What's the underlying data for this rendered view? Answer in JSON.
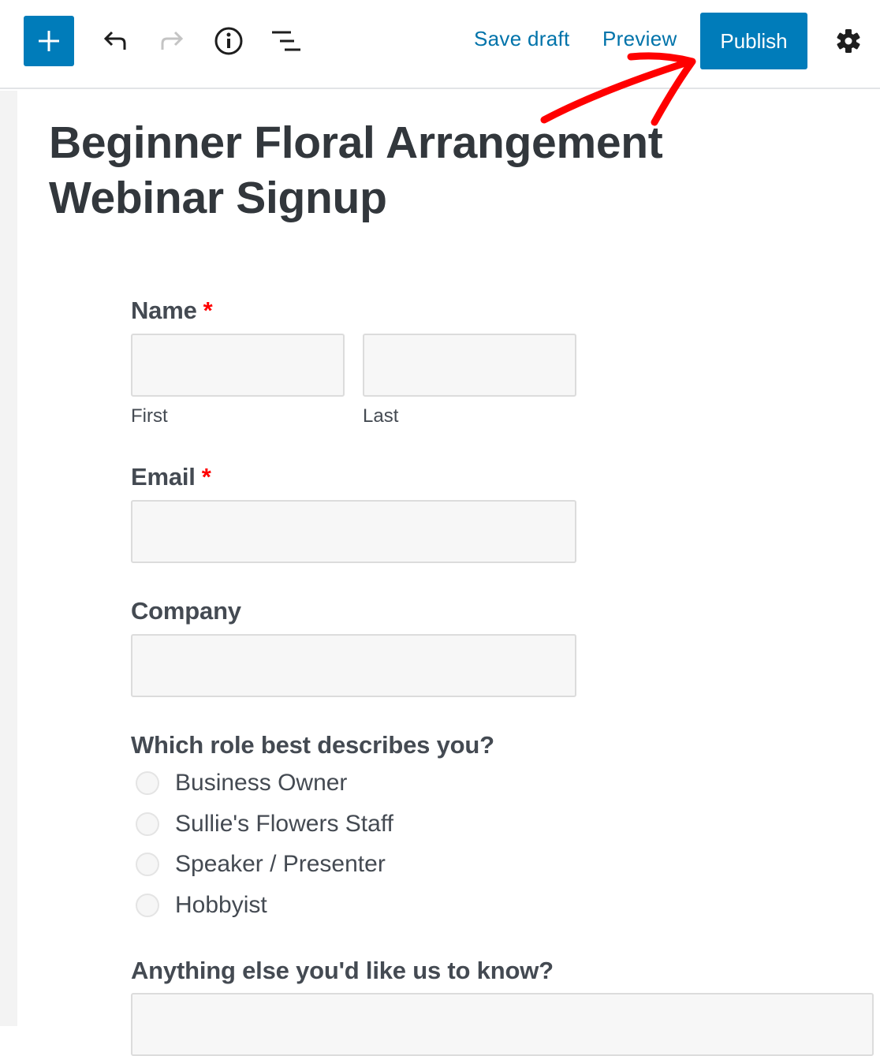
{
  "toolbar": {
    "add_block_icon": "plus-icon",
    "undo_icon": "undo-icon",
    "redo_icon": "redo-icon",
    "info_icon": "info-icon",
    "outline_icon": "list-outline-icon",
    "save_draft_label": "Save draft",
    "preview_label": "Preview",
    "publish_label": "Publish",
    "settings_icon": "gear-icon",
    "accent_color": "#007cba",
    "link_color": "#0073aa"
  },
  "page": {
    "title": "Beginner Floral Arrangement Webinar Signup"
  },
  "form": {
    "name": {
      "label": "Name",
      "required_mark": "*",
      "first_sublabel": "First",
      "last_sublabel": "Last",
      "first_value": "",
      "last_value": ""
    },
    "email": {
      "label": "Email",
      "required_mark": "*",
      "value": ""
    },
    "company": {
      "label": "Company",
      "value": ""
    },
    "role": {
      "label": "Which role best describes you?",
      "options": [
        {
          "label": "Business Owner",
          "checked": false
        },
        {
          "label": "Sullie's Flowers Staff",
          "checked": false
        },
        {
          "label": "Speaker / Presenter",
          "checked": false
        },
        {
          "label": "Hobbyist",
          "checked": false
        }
      ]
    },
    "comments": {
      "label": "Anything else you'd like us to know?",
      "value": ""
    }
  },
  "annotation": {
    "type": "red-arrow",
    "points_to": "Publish",
    "color": "#ff0000"
  }
}
